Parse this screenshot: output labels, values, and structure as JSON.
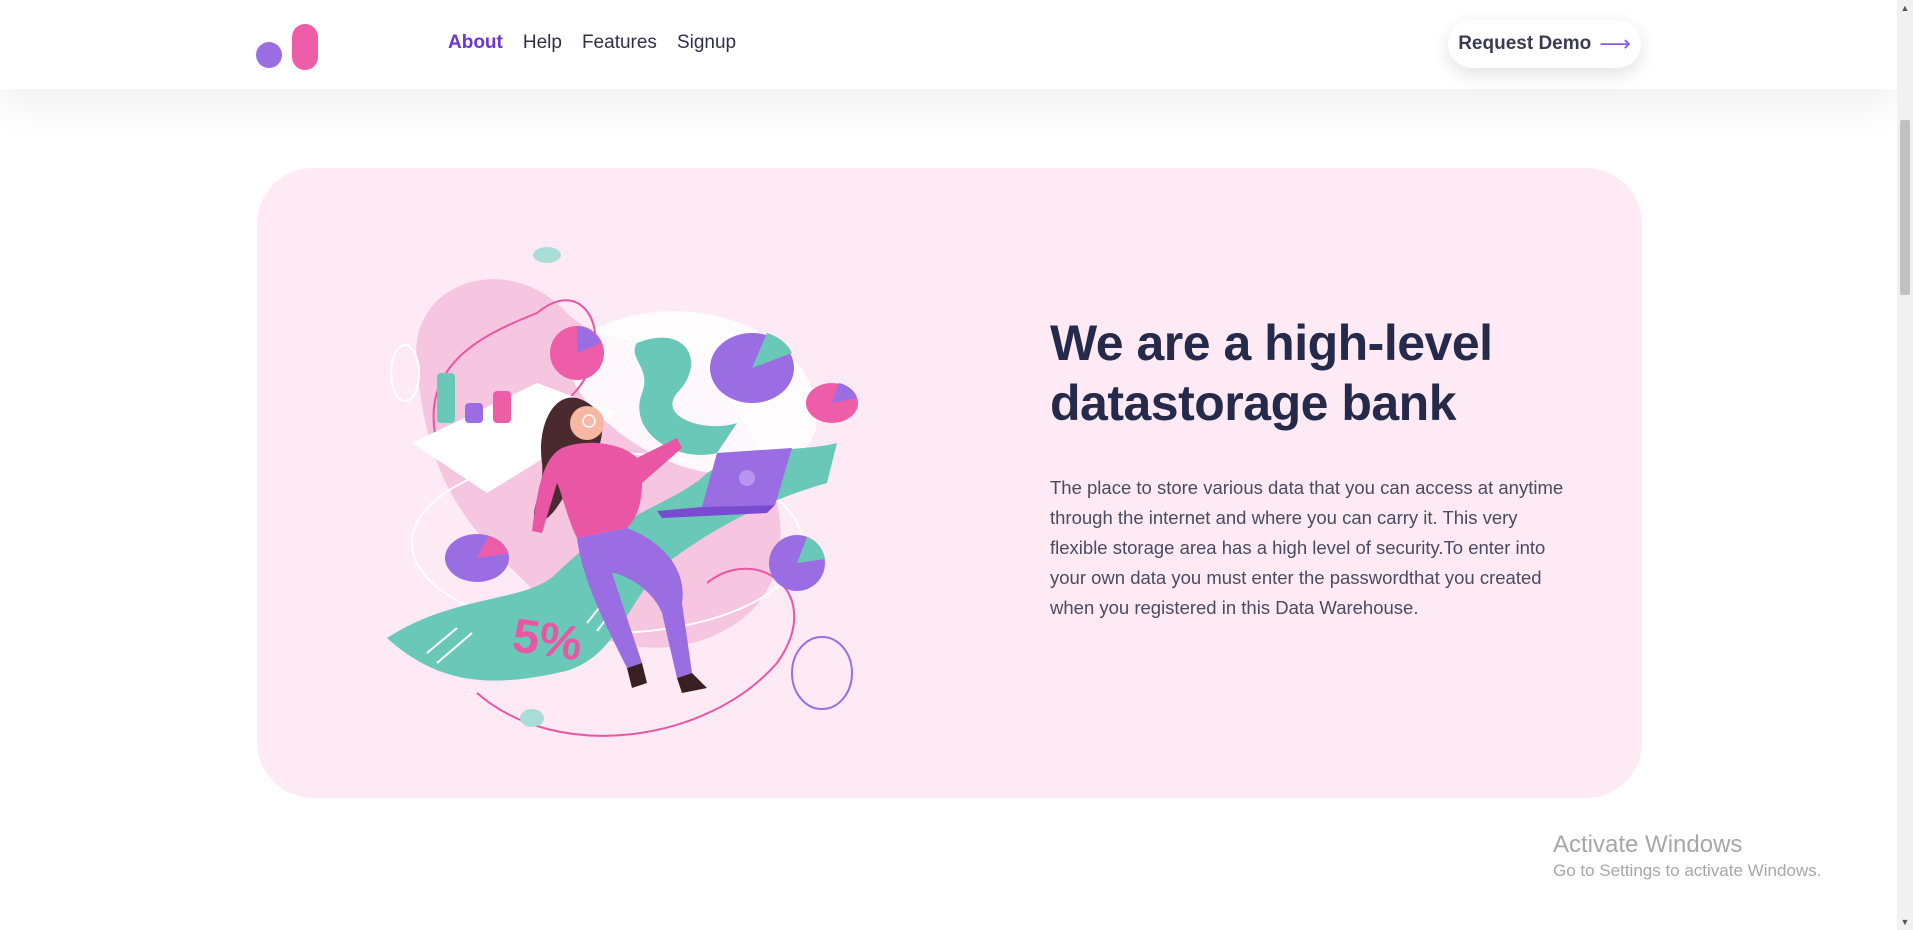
{
  "header": {
    "nav": [
      "About",
      "Help",
      "Features",
      "Signup"
    ],
    "active_nav": "About",
    "cta_label": "Request Demo",
    "cta_icon": "arrow-right-icon"
  },
  "hero": {
    "title": "We are a high-level datastorage bank",
    "description": "The place to store various data that you can access at anytime through the internet and where you can carry it. This very flexible storage area has a high level of security.To enter into your own data you must enter the passwordthat you created when you registered in this Data Warehouse.",
    "illustration_text": "5%"
  },
  "watermark": {
    "line1": "Activate Windows",
    "line2": "Go to Settings to activate Windows."
  },
  "colors": {
    "accent": "#6c35d8",
    "pink": "#ee5da8",
    "purple": "#9b6de3",
    "teal": "#6ac8b8",
    "card_bg": "#fdeaf5",
    "title": "#262a4a"
  }
}
